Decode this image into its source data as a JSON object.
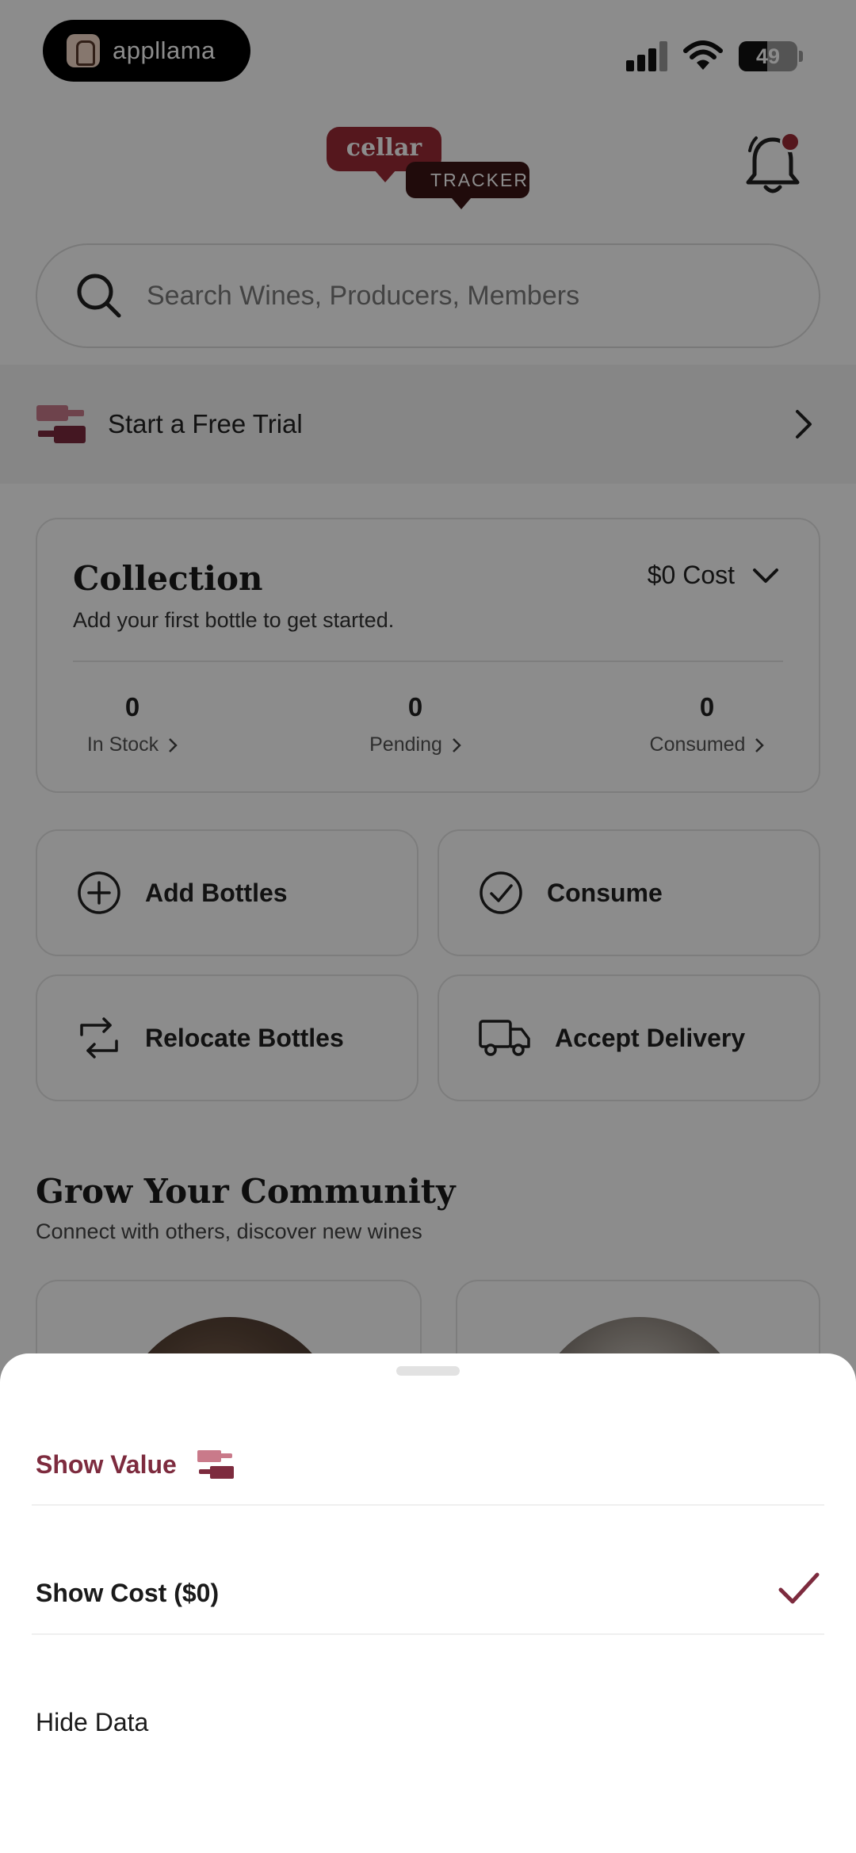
{
  "status_bar": {
    "app_badge": "appllama",
    "battery_percent": "49",
    "battery_level": 0.49
  },
  "header": {
    "logo_top": "cellar",
    "logo_bottom": "TRACKER"
  },
  "search": {
    "placeholder": "Search Wines, Producers, Members"
  },
  "trial_banner": {
    "label": "Start a Free Trial"
  },
  "collection": {
    "title": "Collection",
    "subtitle": "Add your first bottle to get started.",
    "metric_toggle": "$0 Cost",
    "stats": [
      {
        "value": "0",
        "label": "In Stock"
      },
      {
        "value": "0",
        "label": "Pending"
      },
      {
        "value": "0",
        "label": "Consumed"
      }
    ]
  },
  "actions": {
    "add_bottles": "Add Bottles",
    "consume": "Consume",
    "relocate": "Relocate Bottles",
    "accept_delivery": "Accept Delivery"
  },
  "community": {
    "title": "Grow Your Community",
    "subtitle": "Connect with others, discover new wines"
  },
  "sheet": {
    "show_value": "Show Value",
    "show_cost": "Show Cost ($0)",
    "hide_data": "Hide Data",
    "selected": "show_cost"
  },
  "colors": {
    "accent": "#7d2b3e",
    "brand_red": "#9b2a35",
    "brand_dark": "#3b1414"
  }
}
